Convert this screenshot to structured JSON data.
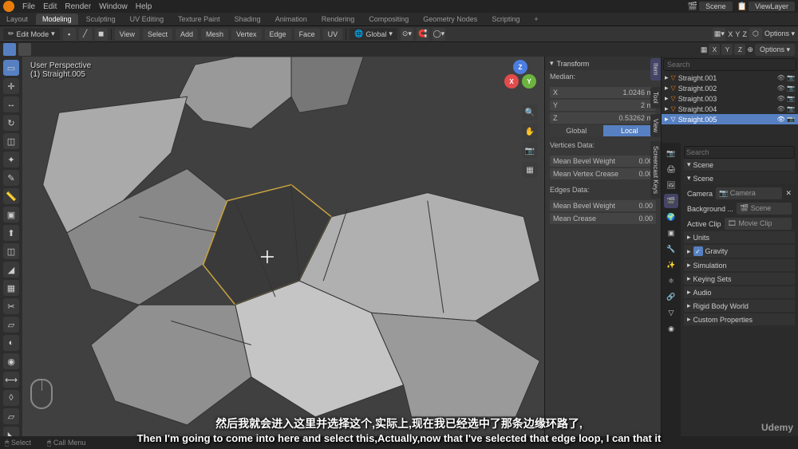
{
  "menu": {
    "file": "File",
    "edit": "Edit",
    "render": "Render",
    "window": "Window",
    "help": "Help"
  },
  "scene": {
    "label": "Scene",
    "viewlayer": "ViewLayer"
  },
  "workspaces": [
    "Layout",
    "Modeling",
    "Sculpting",
    "UV Editing",
    "Texture Paint",
    "Shading",
    "Animation",
    "Rendering",
    "Compositing",
    "Geometry Nodes",
    "Scripting"
  ],
  "active_workspace": "Modeling",
  "toolbar": {
    "mode": "Edit Mode",
    "view": "View",
    "select": "Select",
    "add": "Add",
    "mesh": "Mesh",
    "vertex": "Vertex",
    "edge": "Edge",
    "face": "Face",
    "uv": "UV",
    "orientation": "Global",
    "options": "Options"
  },
  "axes": {
    "x": "X",
    "y": "Y",
    "z": "Z"
  },
  "viewport": {
    "perspective": "User Perspective",
    "object": "(1) Straight.005"
  },
  "transform": {
    "header": "Transform",
    "median": "Median:",
    "x": "X",
    "xv": "1.0246 m",
    "y": "Y",
    "yv": "2 m",
    "z": "Z",
    "zv": "0.53262 m",
    "global": "Global",
    "local": "Local",
    "vertdata": "Vertices Data:",
    "bevelw": "Mean Bevel Weight",
    "bevelv": "0.00",
    "crease": "Mean Vertex Crease",
    "creasev": "0.00",
    "edgedata": "Edges Data:",
    "ebevel": "Mean Bevel Weight",
    "ebevelv": "0.00",
    "ecrease": "Mean Crease",
    "ecreasev": "0.00"
  },
  "side_tabs": {
    "item": "Item",
    "tool": "Tool",
    "view": "View",
    "screencast": "Screencast Keys"
  },
  "outliner": {
    "search": "Search",
    "items": [
      {
        "name": "Straight.001"
      },
      {
        "name": "Straight.002"
      },
      {
        "name": "Straight.003"
      },
      {
        "name": "Straight.004"
      },
      {
        "name": "Straight.005",
        "selected": true
      }
    ]
  },
  "properties": {
    "search": "Search",
    "scene": "Scene",
    "scene2": "Scene",
    "camera": "Camera",
    "camera_obj": "Camera",
    "background": "Background ...",
    "bg_val": "Scene",
    "activeclip": "Active Clip",
    "clip_val": "Movie Clip",
    "units": "Units",
    "gravity": "Gravity",
    "simulation": "Simulation",
    "keying": "Keying Sets",
    "audio": "Audio",
    "rigidbody": "Rigid Body World",
    "custom": "Custom Properties"
  },
  "subtitle_cn": "然后我就会进入这里并选择这个,实际上,现在我已经选中了那条边缘环路了,",
  "subtitle_en": "Then I'm going to come into here and select this,Actually,now that I've selected that edge loop, I can that it",
  "status": {
    "select": "Select",
    "callmenu": "Call Menu"
  },
  "brand": "Udemy"
}
